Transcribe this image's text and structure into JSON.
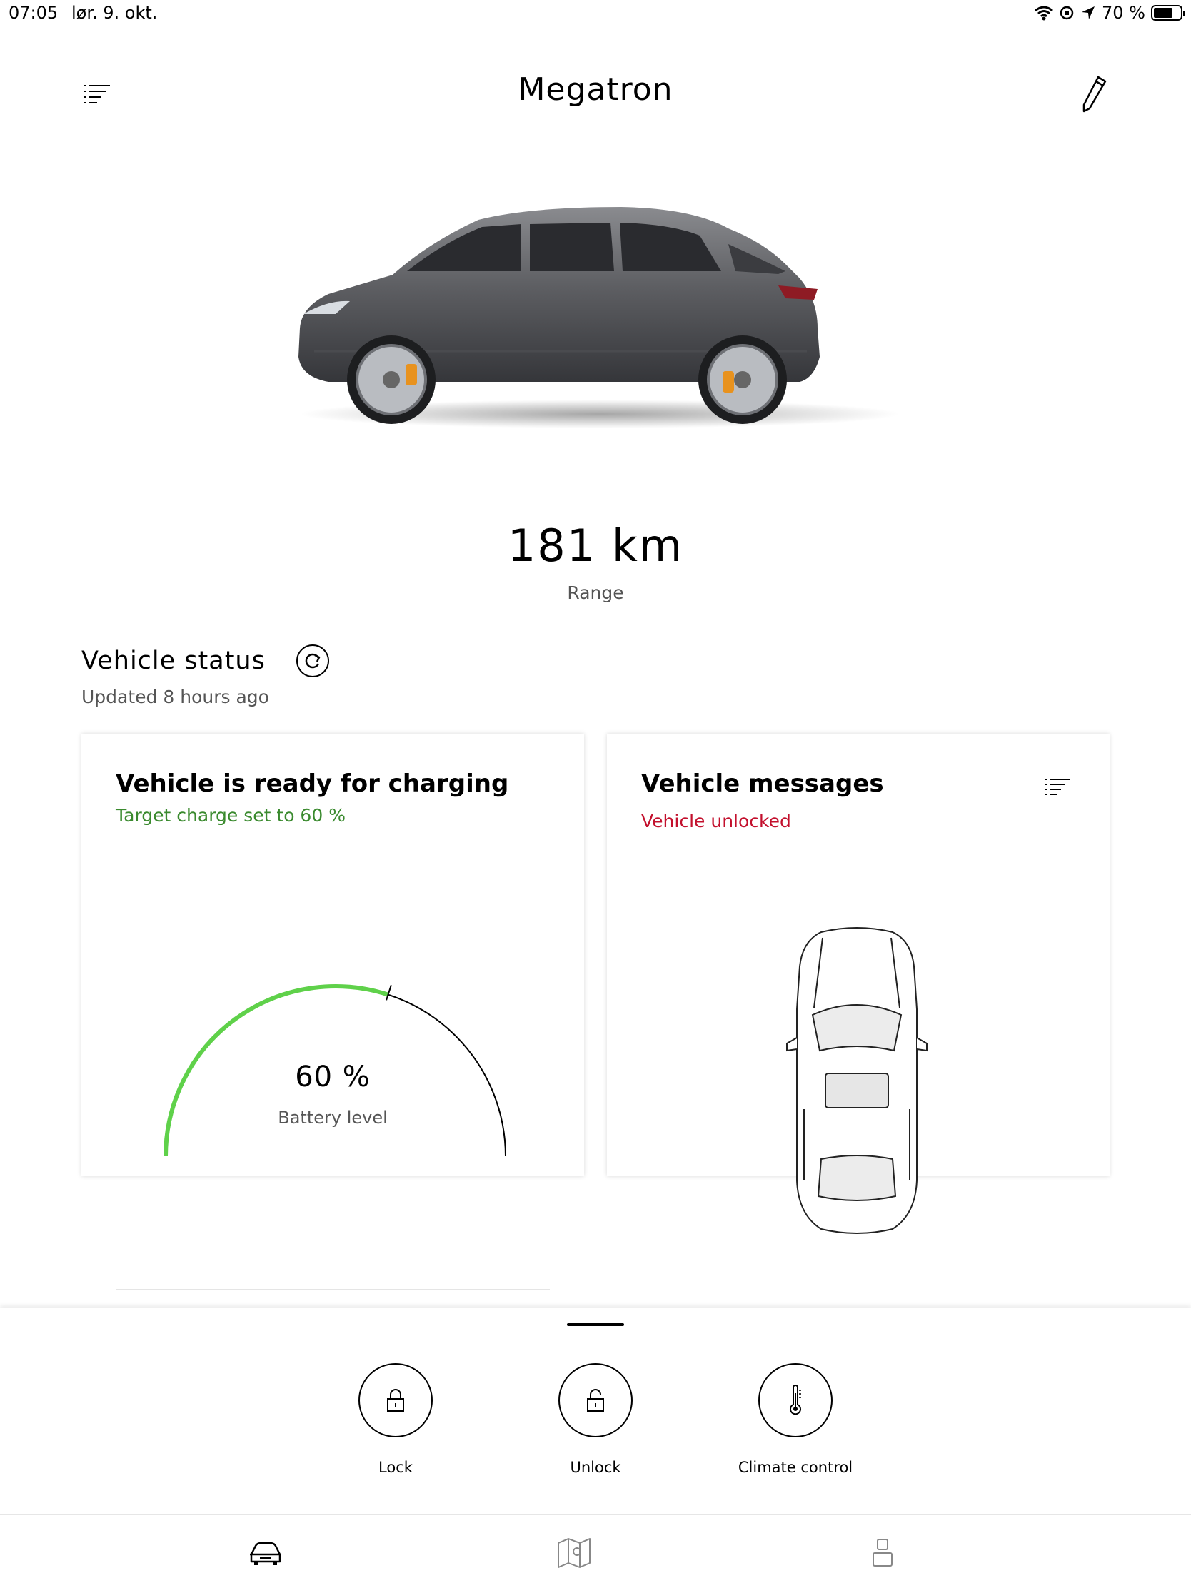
{
  "status_bar": {
    "time": "07:05",
    "date": "lør. 9. okt.",
    "battery_text": "70 %",
    "battery_level": 0.7
  },
  "header": {
    "title": "Megatron",
    "menu_icon": "list-icon",
    "edit_icon": "pencil-icon"
  },
  "range": {
    "value": "181 km",
    "label": "Range"
  },
  "vehicle_status": {
    "title": "Vehicle status",
    "updated": "Updated 8 hours ago"
  },
  "charging_card": {
    "title": "Vehicle is ready for charging",
    "subtitle": "Target charge set to 60 %",
    "battery_value": "60 %",
    "battery_label": "Battery level",
    "battery_fraction": 0.6,
    "target_fraction": 0.6,
    "accent_color": "#5fd14a"
  },
  "messages_card": {
    "title": "Vehicle messages",
    "subtitle": "Vehicle unlocked",
    "alert_color": "#c3102d"
  },
  "actions": [
    {
      "label": "Lock",
      "icon": "lock-icon"
    },
    {
      "label": "Unlock",
      "icon": "unlock-icon"
    },
    {
      "label": "Climate control",
      "icon": "thermometer-icon"
    }
  ],
  "tabs": [
    {
      "icon": "car-icon",
      "active": true
    },
    {
      "icon": "map-icon",
      "active": false
    },
    {
      "icon": "profile-icon",
      "active": false
    }
  ]
}
